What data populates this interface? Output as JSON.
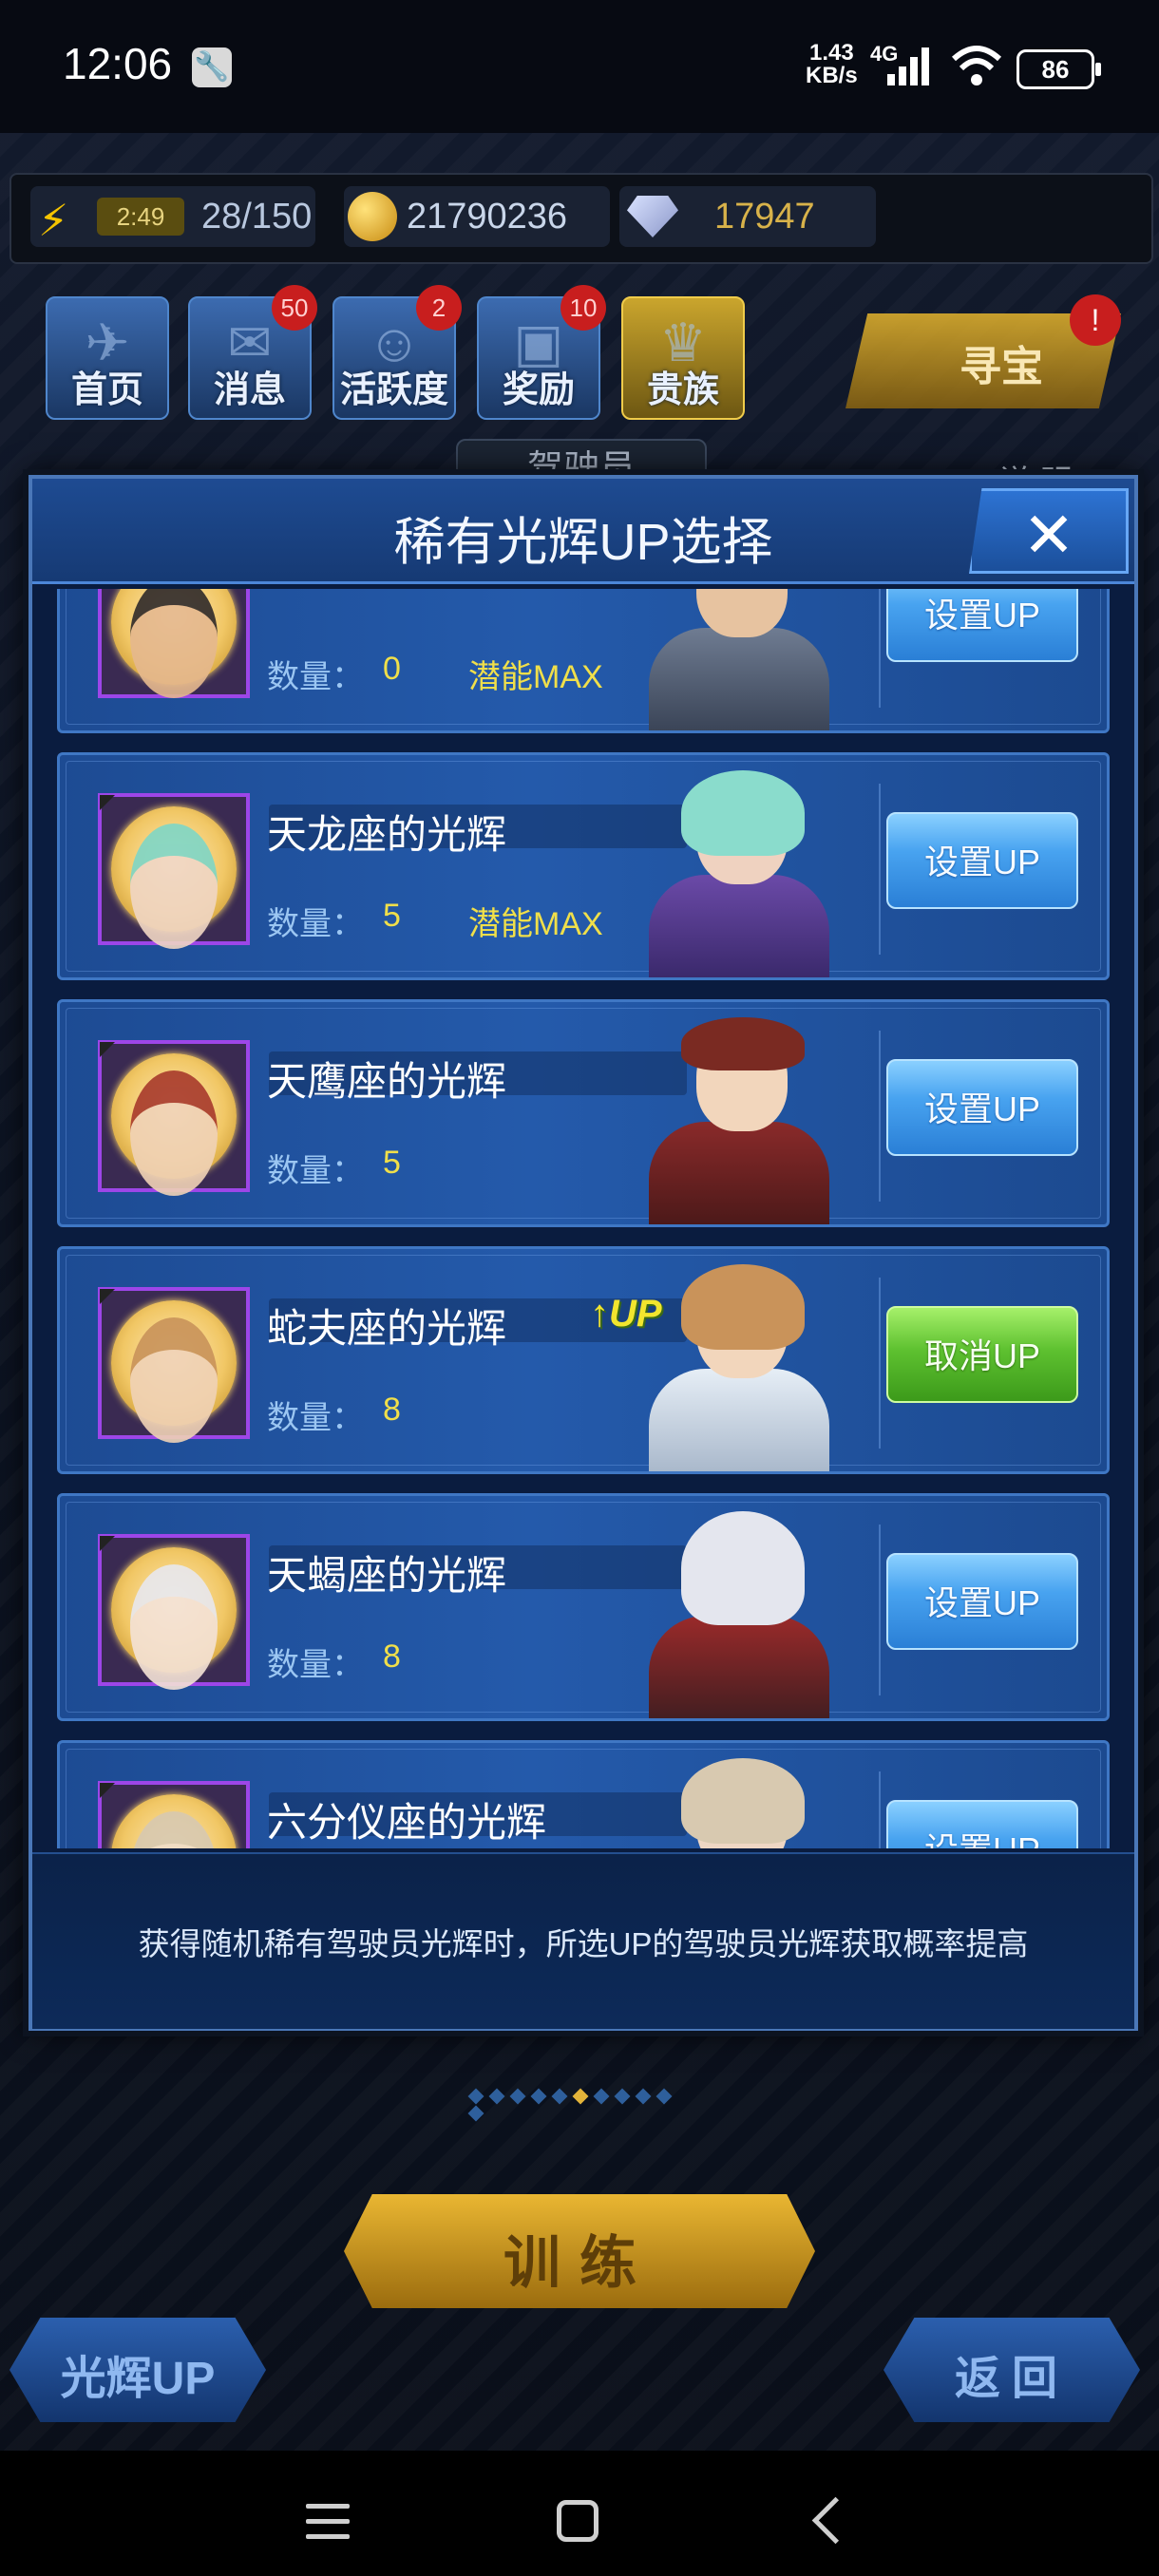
{
  "status_bar": {
    "time": "12:06",
    "net_speed_value": "1.43",
    "net_speed_unit": "KB/s",
    "network": "4G",
    "battery": "86"
  },
  "resources": {
    "energy_timer": "2:49",
    "energy": "28/150",
    "gold": "21790236",
    "gems": "17947"
  },
  "top_menu": [
    {
      "label": "首页",
      "badge": ""
    },
    {
      "label": "消息",
      "badge": "50"
    },
    {
      "label": "活跃度",
      "badge": "2"
    },
    {
      "label": "奖励",
      "badge": "10"
    },
    {
      "label": "贵族",
      "badge": ""
    }
  ],
  "treasure": {
    "label": "寻宝",
    "badge": "!"
  },
  "background_tab": {
    "label": "驾驶员",
    "help": "说 明"
  },
  "dialog": {
    "title": "稀有光辉UP选择",
    "close_icon": "close-icon",
    "qty_label": "数量：",
    "footer_text": "获得随机稀有驾驶员光辉时，所选UP的驾驶员光辉获取概率提高"
  },
  "glows": [
    {
      "name": "",
      "qty": "0",
      "potential": "潜能MAX",
      "button": "设置UP",
      "is_up": false,
      "color": "#2f2a2a"
    },
    {
      "name": "天龙座的光辉",
      "qty": "5",
      "potential": "潜能MAX",
      "button": "设置UP",
      "is_up": false,
      "color": "#7fd6c6"
    },
    {
      "name": "天鹰座的光辉",
      "qty": "5",
      "potential": "",
      "button": "设置UP",
      "is_up": false,
      "color": "#a83a2c"
    },
    {
      "name": "蛇夫座的光辉",
      "qty": "8",
      "potential": "",
      "button": "取消UP",
      "is_up": true,
      "up_tag": "UP",
      "color": "#c9935a"
    },
    {
      "name": "天蝎座的光辉",
      "qty": "8",
      "potential": "",
      "button": "设置UP",
      "is_up": false,
      "color": "#e8e8ee"
    },
    {
      "name": "六分仪座的光辉",
      "qty": "",
      "potential": "",
      "button": "设置UP",
      "is_up": false,
      "color": "#d8c9b0"
    }
  ],
  "bottom": {
    "train": "训练",
    "glow_up": "光辉UP",
    "back": "返回"
  },
  "colors": {
    "button_blue": "#48a3f0",
    "button_green": "#5ec130",
    "highlight_yellow": "#f0df4a",
    "avatar_border": "#9d46e8"
  }
}
